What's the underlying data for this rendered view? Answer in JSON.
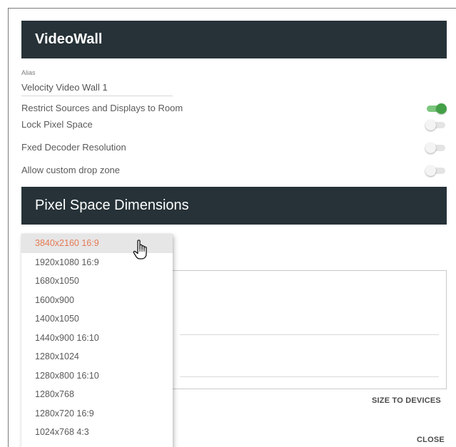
{
  "dialog": {
    "title": "VideoWall",
    "alias": {
      "label": "Alias",
      "value": "Velocity Video Wall 1"
    },
    "toggles": [
      {
        "label": "Restrict Sources and Displays to Room",
        "on": true
      },
      {
        "label": "Lock Pixel Space",
        "on": false
      },
      {
        "label": "Fxed Decoder Resolution",
        "on": false
      },
      {
        "label": "Allow custom drop zone",
        "on": false
      }
    ],
    "pixel_section_title": "Pixel Space Dimensions",
    "size_to_devices_label": "SIZE TO DEVICES",
    "close_label": "CLOSE"
  },
  "dropdown": {
    "highlighted_index": 0,
    "options": [
      "3840x2160 16:9",
      "1920x1080 16:9",
      "1680x1050",
      "1600x900",
      "1400x1050",
      "1440x900 16:10",
      "1280x1024",
      "1280x800 16:10",
      "1280x768",
      "1280x720 16:9",
      "1024x768 4:3"
    ]
  },
  "colors": {
    "header_bg": "#263238",
    "toggle_on": "#43a047",
    "highlight_text": "#e57a55"
  },
  "icons": {
    "cursor": "hand-pointer-icon"
  }
}
